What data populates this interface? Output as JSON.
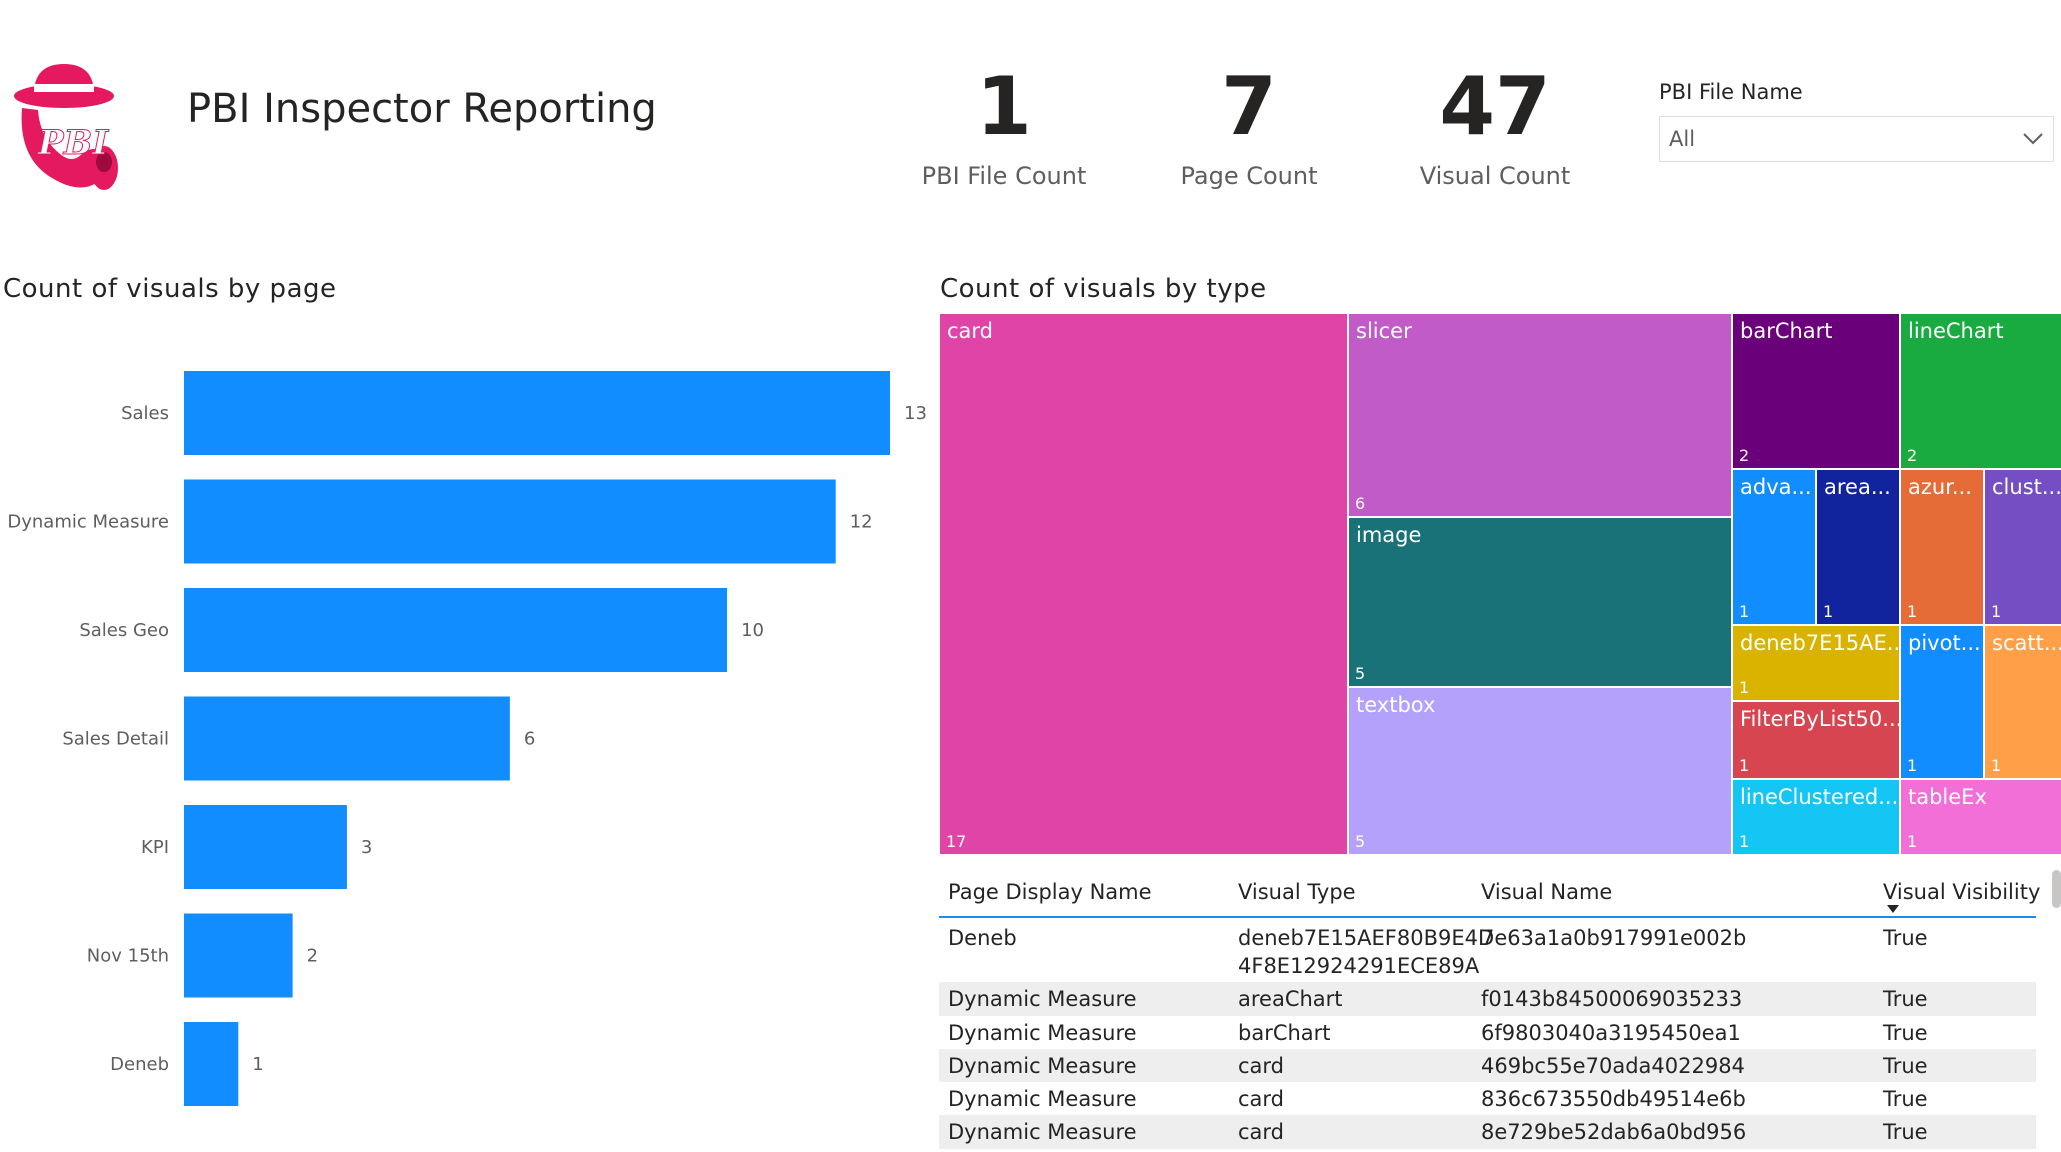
{
  "header": {
    "title": "PBI Inspector Reporting",
    "logo_icon": "pbi-inspector-logo"
  },
  "kpis": [
    {
      "value": "1",
      "label": "PBI File Count"
    },
    {
      "value": "7",
      "label": "Page Count"
    },
    {
      "value": "47",
      "label": "Visual Count"
    }
  ],
  "slicer": {
    "title": "PBI File Name",
    "selected": "All"
  },
  "bar_visual": {
    "title": "Count of visuals by page",
    "color": "#118dff"
  },
  "treemap_visual": {
    "title": "Count of visuals by type",
    "tiles": [
      {
        "label": "card",
        "count": "17",
        "color": "#e044a7"
      },
      {
        "label": "slicer",
        "count": "6",
        "color": "#c05bc7"
      },
      {
        "label": "image",
        "count": "5",
        "color": "#197278"
      },
      {
        "label": "textbox",
        "count": "5",
        "color": "#b3a1fc"
      },
      {
        "label": "barChart",
        "count": "2",
        "color": "#6b007b"
      },
      {
        "label": "lineChart",
        "count": "2",
        "color": "#1aab40"
      },
      {
        "label": "adva...",
        "count": "1",
        "color": "#118dff"
      },
      {
        "label": "area...",
        "count": "1",
        "color": "#12239e"
      },
      {
        "label": "azur...",
        "count": "1",
        "color": "#e66c37"
      },
      {
        "label": "clust...",
        "count": "1",
        "color": "#744ec2"
      },
      {
        "label": "deneb7E15AE...",
        "count": "1",
        "color": "#d9b300"
      },
      {
        "label": "pivot...",
        "count": "1",
        "color": "#118dff"
      },
      {
        "label": "scatt...",
        "count": "1",
        "color": "#ff9f48"
      },
      {
        "label": "FilterByList50...",
        "count": "1",
        "color": "#d64550"
      },
      {
        "label": "lineClustered...",
        "count": "1",
        "color": "#15c6f4"
      },
      {
        "label": "tableEx",
        "count": "1",
        "color": "#f16fd7"
      }
    ]
  },
  "chart_data": {
    "type": "bar",
    "orientation": "horizontal",
    "title": "Count of visuals by page",
    "categories": [
      "Sales",
      "Dynamic Measure",
      "Sales Geo",
      "Sales Detail",
      "KPI",
      "Nov 15th",
      "Deneb"
    ],
    "values": [
      13,
      12,
      10,
      6,
      3,
      2,
      1
    ],
    "xlim": [
      0,
      13
    ],
    "data_labels": true,
    "grid": false
  },
  "table": {
    "headers": [
      "Page Display Name",
      "Visual Type",
      "Visual Name",
      "Visual Visibility"
    ],
    "rows": [
      [
        "Deneb",
        "deneb7E15AEF80B9E4D",
        "7e63a1a0b917991e002b",
        "True"
      ],
      [
        "Dynamic Measure",
        "areaChart",
        "f0143b84500069035233",
        "True"
      ],
      [
        "Dynamic Measure",
        "barChart",
        "6f9803040a3195450ea1",
        "True"
      ],
      [
        "Dynamic Measure",
        "card",
        "469bc55e70ada4022984",
        "True"
      ],
      [
        "Dynamic Measure",
        "card",
        "836c673550db49514e6b",
        "True"
      ],
      [
        "Dynamic Measure",
        "card",
        "8e729be52dab6a0bd956",
        "True"
      ]
    ],
    "row0_type_line2": "4F8E12924291ECE89A"
  }
}
